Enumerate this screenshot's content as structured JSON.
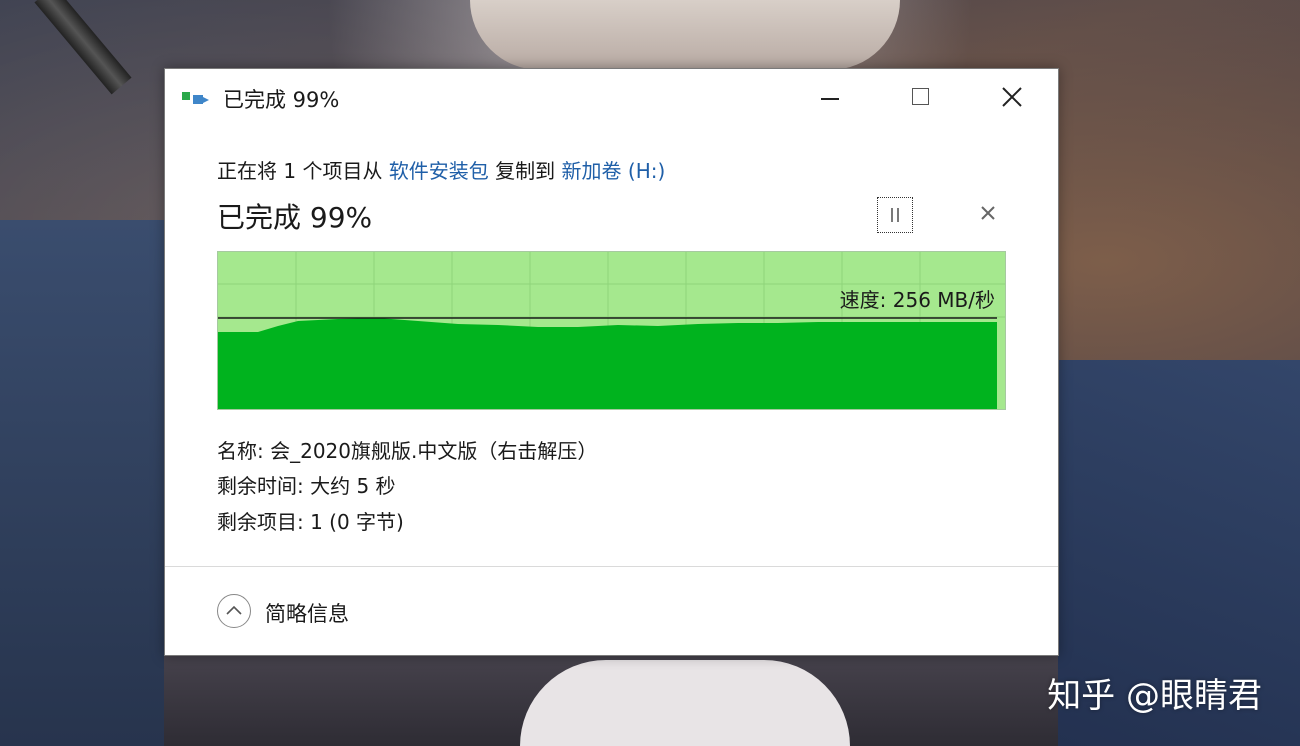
{
  "window": {
    "title": "已完成 99%",
    "controls": {
      "minimize": "minimize",
      "maximize": "maximize",
      "close": "close"
    }
  },
  "copy": {
    "prefix": "正在将 1 个项目从",
    "source": "软件安装包",
    "middle": "复制到",
    "destination": "新加卷",
    "dest_suffix": "(H:)",
    "status": "已完成 99%",
    "progress_fraction": 0.99
  },
  "graph": {
    "speed_text": "速度: 256 MB/秒",
    "colors": {
      "fill": "#00b31e",
      "background": "#a5e88e",
      "grid": "#8fd47a",
      "line": "#1a1a1a"
    }
  },
  "details": {
    "name": "名称: 会_2020旗舰版.中文版（右击解压）",
    "time_remaining": "剩余时间: 大约 5 秒",
    "items_remaining": "剩余项目: 1 (0 字节)"
  },
  "footer": {
    "toggle_label": "简略信息"
  },
  "watermark": "知乎 @眼睛君",
  "icons": [
    "copy-icon",
    "pause-icon",
    "cancel-icon",
    "chevron-up-icon"
  ]
}
